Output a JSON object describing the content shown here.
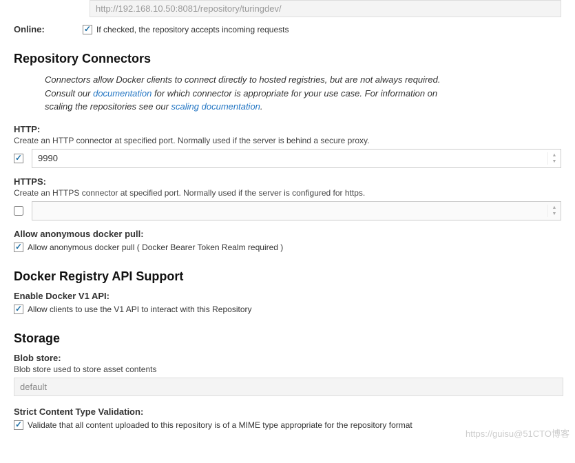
{
  "url_box": "http://192.168.10.50:8081/repository/turingdev/",
  "online": {
    "label": "Online:",
    "checked": true,
    "help": "If checked, the repository accepts incoming requests"
  },
  "connectors": {
    "heading": "Repository Connectors",
    "desc_prefix": "Connectors allow Docker clients to connect directly to hosted registries, but are not always required. Consult our ",
    "doc_link": "documentation",
    "desc_mid": " for which connector is appropriate for your use case. For information on scaling the repositories see our ",
    "scale_link": "scaling documentation",
    "desc_suffix": ".",
    "http": {
      "label": "HTTP:",
      "help": "Create an HTTP connector at specified port. Normally used if the server is behind a secure proxy.",
      "checked": true,
      "value": "9990"
    },
    "https": {
      "label": "HTTPS:",
      "help": "Create an HTTPS connector at specified port. Normally used if the server is configured for https.",
      "checked": false,
      "value": ""
    },
    "anon": {
      "label": "Allow anonymous docker pull:",
      "checked": true,
      "text": "Allow anonymous docker pull ( Docker Bearer Token Realm required )"
    }
  },
  "api": {
    "heading": "Docker Registry API Support",
    "v1": {
      "label": "Enable Docker V1 API:",
      "checked": true,
      "text": "Allow clients to use the V1 API to interact with this Repository"
    }
  },
  "storage": {
    "heading": "Storage",
    "blob": {
      "label": "Blob store:",
      "help": "Blob store used to store asset contents",
      "value": "default"
    },
    "strict": {
      "label": "Strict Content Type Validation:",
      "checked": true,
      "text": "Validate that all content uploaded to this repository is of a MIME type appropriate for the repository format"
    }
  },
  "watermark": "https://guisu@51CTO博客"
}
